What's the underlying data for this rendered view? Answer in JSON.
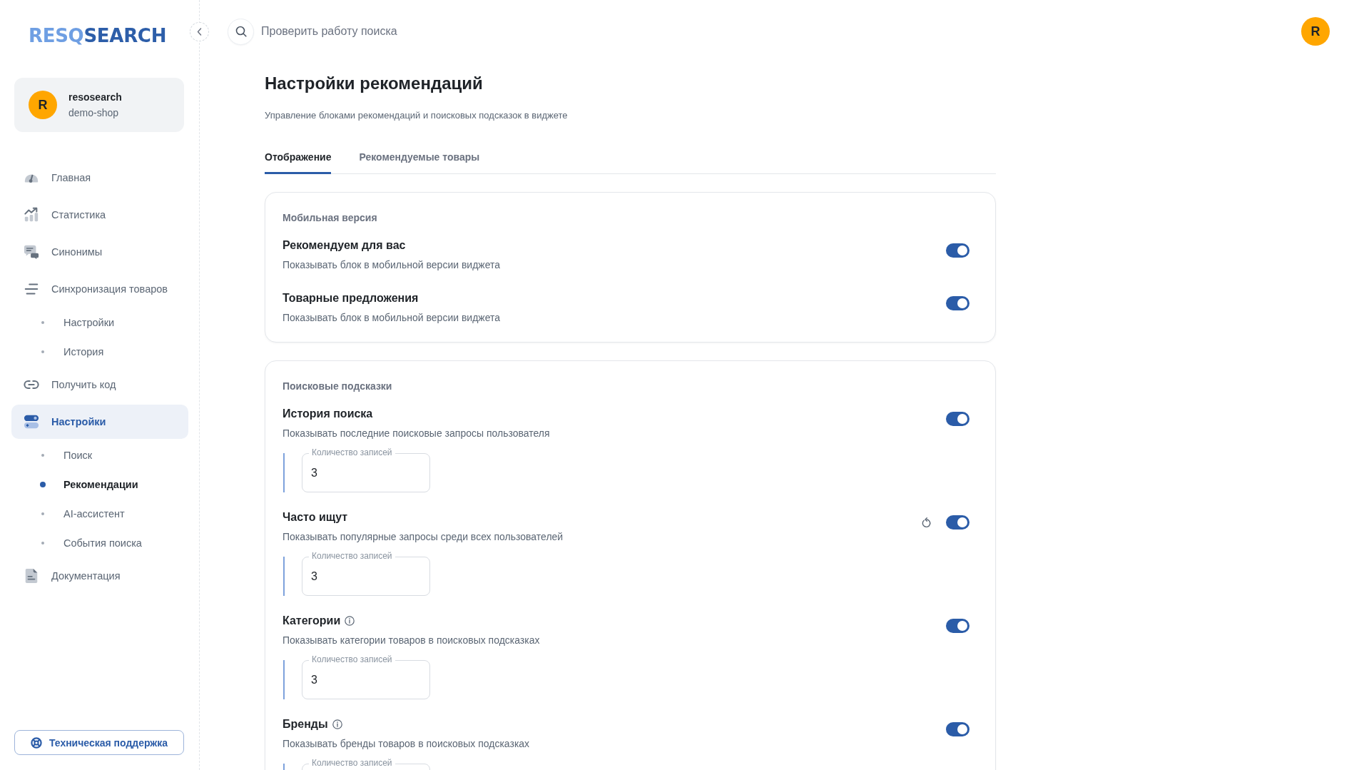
{
  "sidebar": {
    "logo": {
      "prefix": "RESQ",
      "suffix": "SEARCH"
    },
    "account": {
      "initial": "R",
      "name": "resosearch",
      "shop": "demo-shop"
    },
    "items": [
      {
        "label": "Главная",
        "selected": false
      },
      {
        "label": "Статистика",
        "selected": false
      },
      {
        "label": "Синонимы",
        "selected": false
      },
      {
        "label": "Синхронизация товаров",
        "selected": false,
        "children": [
          {
            "label": "Настройки",
            "selected": false
          },
          {
            "label": "История",
            "selected": false
          }
        ]
      },
      {
        "label": "Получить код",
        "selected": false
      },
      {
        "label": "Настройки",
        "selected": true,
        "children": [
          {
            "label": "Поиск",
            "selected": false
          },
          {
            "label": "Рекомендации",
            "selected": true
          },
          {
            "label": "AI-ассистент",
            "selected": false
          },
          {
            "label": "События поиска",
            "selected": false
          }
        ]
      },
      {
        "label": "Документация",
        "selected": false
      }
    ],
    "support_button": "Техническая поддержка"
  },
  "header": {
    "search_prompt": "Проверить работу поиска",
    "user_initial": "R"
  },
  "page": {
    "title": "Настройки рекомендаций",
    "subtitle": "Управление блоками рекомендаций и поисковых подсказок в виджете",
    "tabs": [
      {
        "label": "Отображение",
        "selected": true
      },
      {
        "label": "Рекомендуемые товары",
        "selected": false
      }
    ]
  },
  "sections": [
    {
      "heading": "Мобильная версия",
      "settings": [
        {
          "title": "Рекомендуем для вас",
          "description": "Показывать блок в мобильной версии виджета",
          "on": true
        },
        {
          "title": "Товарные предложения",
          "description": "Показывать блок в мобильной версии виджета",
          "on": true
        }
      ]
    },
    {
      "heading": "Поисковые подсказки",
      "settings": [
        {
          "title": "История поиска",
          "description": "Показывать последние поисковые запросы пользователя",
          "on": true,
          "count_field": {
            "label": "Количество записей",
            "value": "3"
          }
        },
        {
          "title": "Часто ищут",
          "description": "Показывать популярные запросы среди всех пользователей",
          "on": true,
          "reset_button": true,
          "count_field": {
            "label": "Количество записей",
            "value": "3"
          }
        },
        {
          "title": "Категории",
          "info_hint": true,
          "description": "Показывать категории товаров в поисковых подсказках",
          "on": true,
          "count_field": {
            "label": "Количество записей",
            "value": "3"
          }
        },
        {
          "title": "Бренды",
          "info_hint": true,
          "description": "Показывать бренды товаров в поисковых подсказках",
          "on": true,
          "count_field": {
            "label": "Количество записей"
          }
        }
      ]
    }
  ]
}
